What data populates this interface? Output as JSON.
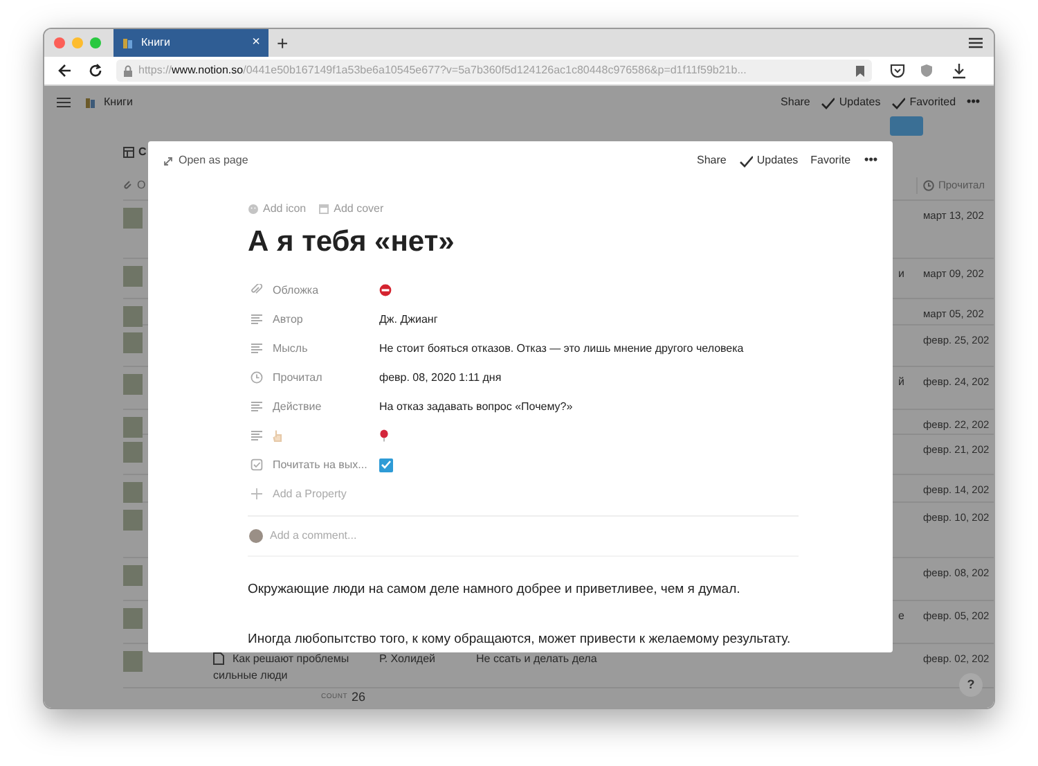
{
  "browser": {
    "tab": {
      "title": "Книги",
      "close": "×",
      "selected": true
    },
    "new_tab": "+",
    "url_prefix": "https://",
    "url_host": "www.notion.so",
    "url_rest": "/0441e50b167149f1a53be6a10545e677?v=5a7b360f5d124126ac1c80448c976586&p=d1f11f59b21b..."
  },
  "topbar": {
    "breadcrumb": "Книги",
    "actions": [
      {
        "label": "Share",
        "check": false
      },
      {
        "label": "Updates",
        "check": true
      },
      {
        "label": "Favorited",
        "check": true
      }
    ],
    "more": "•••"
  },
  "table": {
    "view_tab": "С",
    "column_1": "О",
    "date_header": "Прочитал",
    "rows": [
      {
        "date": "март 13, 202"
      },
      {
        "date": "март 09, 202",
        "column_3": "и"
      },
      {
        "date": "март 05, 202"
      },
      {
        "date": "февр. 25, 202"
      },
      {
        "date": "февр. 24, 202",
        "column_3": "й"
      },
      {
        "date": "февр. 22, 202"
      },
      {
        "date": "февр. 21, 202"
      },
      {
        "date": "февр. 14, 202"
      },
      {
        "date": "февр. 10, 202"
      },
      {
        "date": "февр. 08, 202"
      },
      {
        "date": "февр. 05, 202",
        "column_3": "е"
      },
      {
        "date": "февр. 02, 202",
        "name": "Как решают проблемы сильные люди",
        "author": "Р. Холидей",
        "thought": "Не ссать и делать дела"
      }
    ],
    "count_label": "COUNT",
    "count": "26"
  },
  "help": "?",
  "modal": {
    "open_as_page": "Open as page",
    "actions": [
      {
        "label": "Share",
        "check": false
      },
      {
        "label": "Updates",
        "check": true
      },
      {
        "label": "Favorite",
        "check": false
      }
    ],
    "more": "•••",
    "add_icon": "Add icon",
    "add_cover": "Add cover",
    "title": "А я тебя «нет»",
    "properties": [
      {
        "name": "Обложка",
        "kind": "file"
      },
      {
        "name": "Автор",
        "kind": "text",
        "value": "Дж. Джианг"
      },
      {
        "name": "Мысль",
        "kind": "text",
        "value": "Не стоит бояться отказов. Отказ — это лишь мнение другого человека"
      },
      {
        "name": "Прочитал",
        "kind": "date",
        "value": "февр. 08, 2020 1:11 дня"
      },
      {
        "name": "Действие",
        "kind": "text",
        "value": "На отказ задавать вопрос «Почему?»"
      },
      {
        "kind": "marker"
      },
      {
        "name": "Почитать на вых...",
        "kind": "checkbox",
        "checked": true
      }
    ],
    "add_property": "Add a Property",
    "comment_placeholder": "Add a comment...",
    "paragraphs": [
      "Окружающие люди на самом деле намного добрее и приветливее, чем я думал.",
      "Иногда любопытство того, к кому обращаются, может привести к желаемому результату."
    ]
  }
}
